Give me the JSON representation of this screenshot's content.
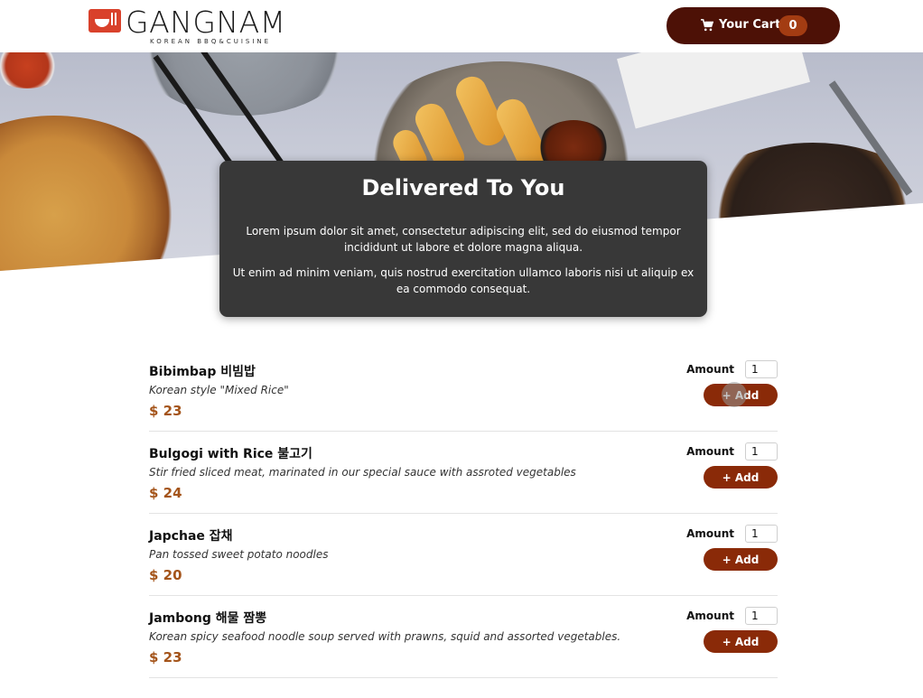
{
  "header": {
    "brand": "GANGNAM",
    "tagline": "KOREAN BBQ&CUISINE",
    "cart_label": "Your Cart",
    "cart_count": "0",
    "cart_icon": "shopping-cart-icon",
    "colors": {
      "cart_bg": "#4d1106",
      "badge_bg": "#a33c12",
      "logo_red": "#d9412b"
    }
  },
  "hero": {
    "title": "Delivered To You",
    "paragraph1": "Lorem ipsum dolor sit amet, consectetur adipiscing elit, sed do eiusmod tempor incididunt ut labore et dolore magna aliqua.",
    "paragraph2": "Ut enim ad minim veniam, quis nostrud exercitation ullamco laboris nisi ut aliquip ex ea commodo consequat."
  },
  "menu": {
    "amount_label": "Amount",
    "add_label": "+ Add",
    "accent_color": "#8a2a08",
    "price_color": "#a4541a",
    "meals": [
      {
        "name": "Bibimbap 비빔밥",
        "description": "Korean style \"Mixed Rice\"",
        "price": "$ 23",
        "amount": "1"
      },
      {
        "name": "Bulgogi with Rice 불고기",
        "description": "Stir fried sliced meat, marinated in our special sauce with assroted vegetables",
        "price": "$ 24",
        "amount": "1"
      },
      {
        "name": "Japchae 잡채",
        "description": "Pan tossed sweet potato noodles",
        "price": "$ 20",
        "amount": "1"
      },
      {
        "name": "Jambong 해물 짬뽕",
        "description": "Korean spicy seafood noodle soup served with prawns, squid and assorted vegetables.",
        "price": "$ 23",
        "amount": "1"
      }
    ]
  }
}
